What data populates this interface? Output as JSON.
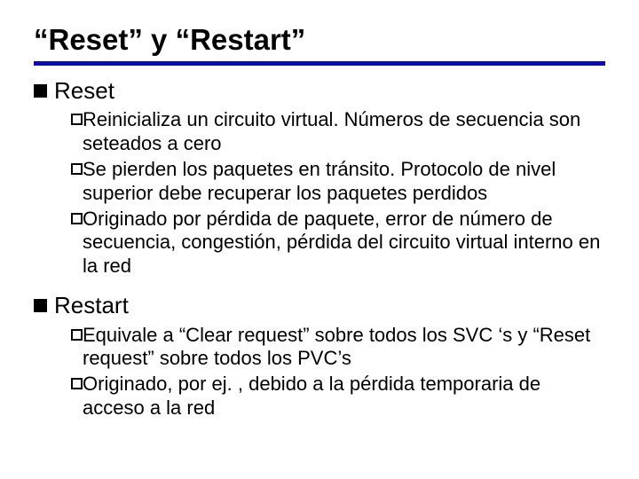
{
  "title": "“Reset” y “Restart”",
  "sections": [
    {
      "heading": "Reset",
      "items": [
        "Reinicializa un circuito virtual. Números de secuencia son seteados a cero",
        "Se pierden los paquetes en tránsito. Protocolo de nivel superior debe recuperar los paquetes perdidos",
        "Originado por pérdida de paquete, error de número de secuencia, congestión, pérdida del circuito virtual interno en la red"
      ]
    },
    {
      "heading": "Restart",
      "items": [
        "Equivale a “Clear request” sobre todos los SVC ‘s y “Reset request” sobre todos los PVC’s",
        "Originado, por ej. , debido a la pérdida temporaria de acceso a la red"
      ]
    }
  ]
}
